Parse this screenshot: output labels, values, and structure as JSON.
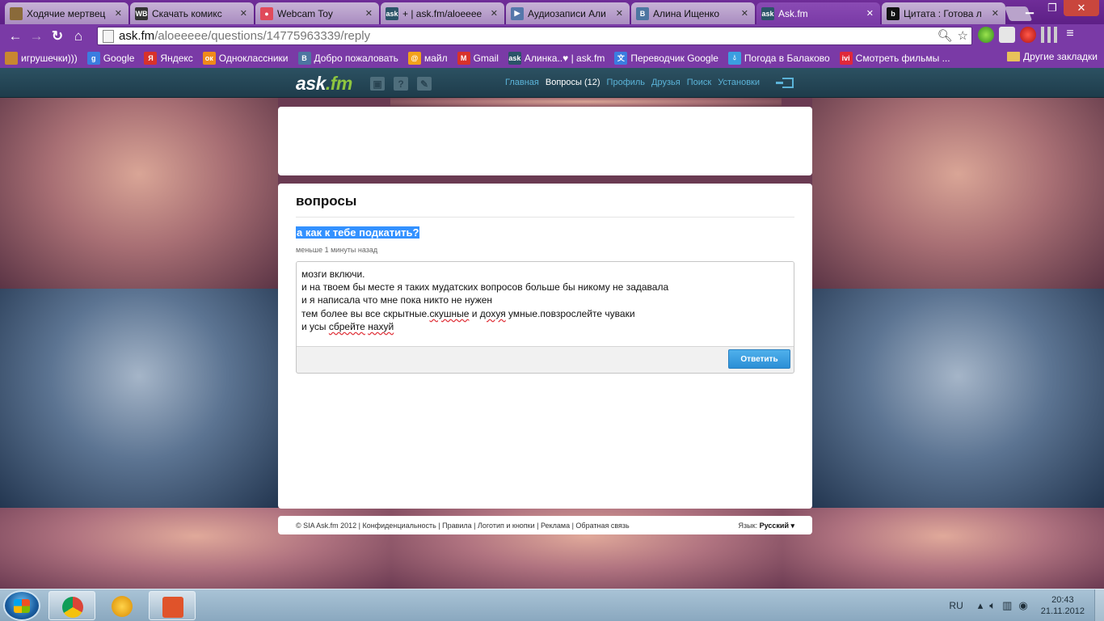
{
  "browser": {
    "tabs": [
      {
        "title": "Ходячие мертвец",
        "icon": "comic-cover-icon",
        "active": false
      },
      {
        "title": "Скачать комикс ",
        "icon": "wb-site-icon",
        "active": false
      },
      {
        "title": "Webcam Toy",
        "icon": "webcam-icon",
        "active": false
      },
      {
        "title": "+ | ask.fm/aloeeee",
        "icon": "askfm-icon",
        "active": false
      },
      {
        "title": "Аудиозаписи Али",
        "icon": "audio-icon",
        "active": false
      },
      {
        "title": "Алина Ищенко",
        "icon": "vk-icon",
        "active": false
      },
      {
        "title": "Ask.fm",
        "icon": "askfm-icon",
        "active": true
      },
      {
        "title": "Цитата : Готова л",
        "icon": "b-site-icon",
        "active": false
      }
    ],
    "address": {
      "host": "ask.fm",
      "path": "/aloeeeee/questions/14775963339/reply"
    },
    "bookmarks": [
      {
        "label": "игрушечки)))",
        "icon": "bookmark-image-icon",
        "color": "#c9872f"
      },
      {
        "label": "Google",
        "icon": "google-icon",
        "color": "#3b7de0"
      },
      {
        "label": "Яндекс",
        "icon": "yandex-icon",
        "color": "#d8322a"
      },
      {
        "label": "Одноклассники",
        "icon": "odnoklassniki-icon",
        "color": "#f08a19"
      },
      {
        "label": "Добро пожаловать",
        "icon": "vk-icon",
        "color": "#4d76a1"
      },
      {
        "label": "майл",
        "icon": "mail-ru-icon",
        "color": "#f2a21b"
      },
      {
        "label": "Gmail",
        "icon": "gmail-icon",
        "color": "#d8322a"
      },
      {
        "label": "Алинка..♥ | ask.fm",
        "icon": "askfm-icon",
        "color": "#2b5468"
      },
      {
        "label": "Переводчик Google",
        "icon": "translate-icon",
        "color": "#3b7de0"
      },
      {
        "label": "Погода в Балаково",
        "icon": "weather-drop-icon",
        "color": "#3b9fe0"
      },
      {
        "label": "Смотреть фильмы ...",
        "icon": "ivi-icon",
        "color": "#e0283a"
      }
    ],
    "other_bookmarks": "Другие закладки"
  },
  "askfm": {
    "logo": {
      "main": "ask",
      "suffix": ".fm"
    },
    "nav": [
      {
        "label": "Главная",
        "current": false
      },
      {
        "label": "Вопросы (12)",
        "current": true
      },
      {
        "label": "Профиль",
        "current": false
      },
      {
        "label": "Друзья",
        "current": false
      },
      {
        "label": "Поиск",
        "current": false
      },
      {
        "label": "Установки",
        "current": false
      }
    ],
    "section_title": "вопросы",
    "question": "а как к тебе подкатить?",
    "question_time": "меньше 1 минуты назад",
    "answer_lines": [
      "мозги включи.",
      "и на твоем бы месте я таких мудатских вопросов больше бы никому не задавала",
      "и я написала что мне пока никто не нужен"
    ],
    "answer_line4": {
      "a": "тем более вы все скрытные.",
      "b": "скушные",
      "c": " и ",
      "d": "дохуя",
      "e": " умные.повзрослейте чуваки"
    },
    "answer_line5": {
      "a": "и усы ",
      "b": "сбрейте",
      "c": " ",
      "d": "нахуй"
    },
    "submit_label": "Ответить",
    "footer_links": "© SIA Ask.fm 2012 | Конфиденциальность | Правила | Логотип и кнопки | Реклама | Обратная связь",
    "language_label": "Язык:",
    "language_value": "Русский ▾"
  },
  "taskbar": {
    "lang": "RU",
    "time": "20:43",
    "date": "21.11.2012"
  }
}
